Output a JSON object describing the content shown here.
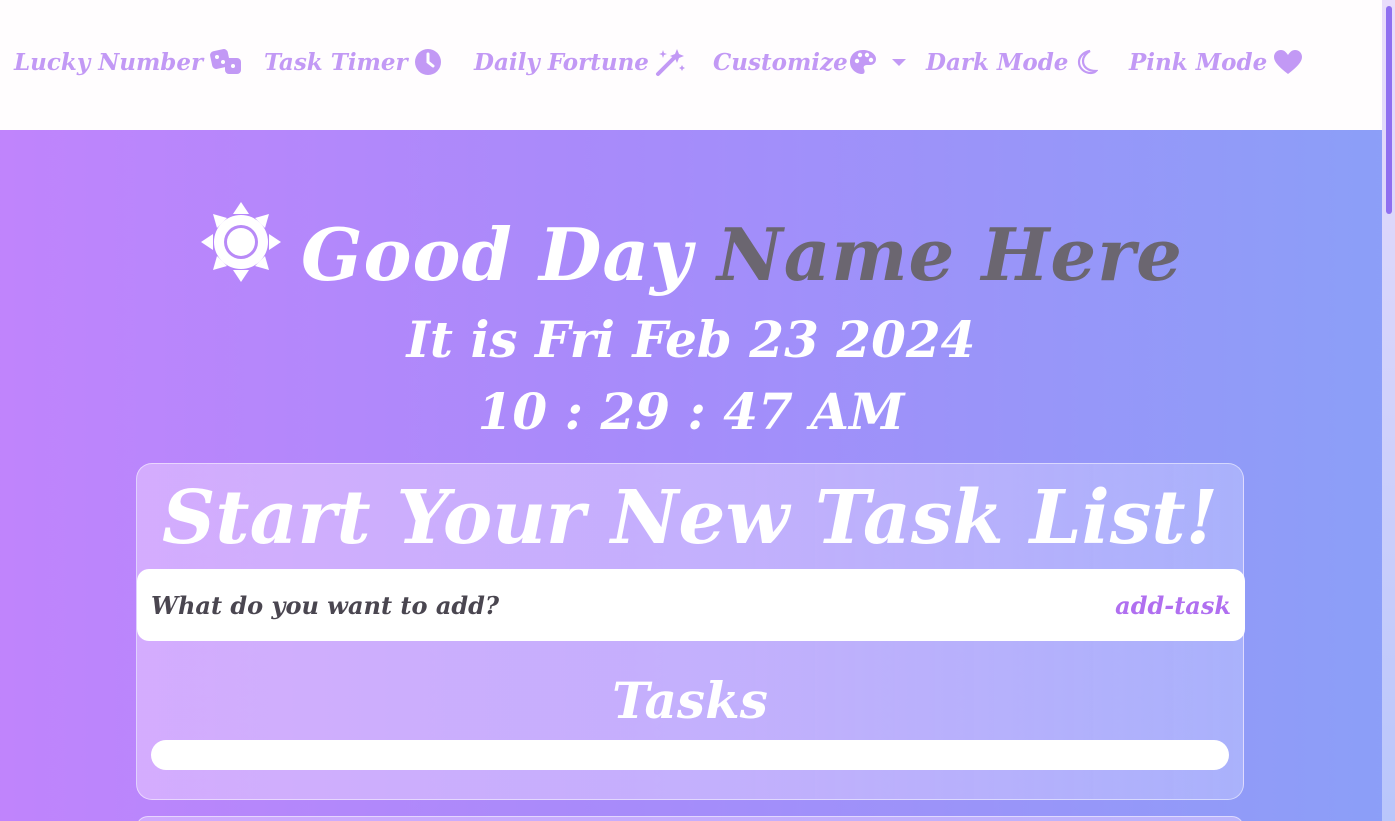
{
  "nav": {
    "items": [
      {
        "label": "Lucky Number",
        "icon": "dice-icon"
      },
      {
        "label": "Task Timer",
        "icon": "clock-icon"
      },
      {
        "label": "Daily Fortune",
        "icon": "magic-wand-icon"
      },
      {
        "label": "Customize",
        "icon": "palette-icon",
        "dropdown": true
      },
      {
        "label": "Dark Mode",
        "icon": "moon-icon"
      },
      {
        "label": "Pink Mode",
        "icon": "heart-icon"
      }
    ]
  },
  "greeting": {
    "icon": "sun-icon",
    "text": "Good Day",
    "name": "Name Here"
  },
  "date_line": "It is Fri Feb 23 2024",
  "time_line": "10 : 29 : 47 AM",
  "task_card": {
    "title": "Start Your New Task List!",
    "input_placeholder": "What do you want to add?",
    "add_button_label": "add-task",
    "tasks_heading": "Tasks",
    "tasks": []
  },
  "colors": {
    "nav_text": "#c299f5",
    "gradient_start": "#c084fc",
    "gradient_end": "#8b9ff8",
    "name_color": "#6b6670",
    "add_button": "#b06ff0"
  }
}
